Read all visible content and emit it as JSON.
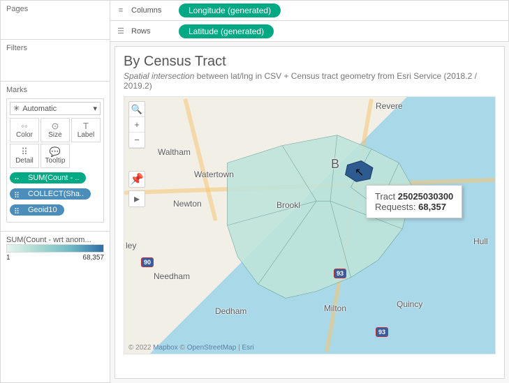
{
  "sidebar": {
    "pages_title": "Pages",
    "filters_title": "Filters",
    "marks_title": "Marks",
    "mark_type": "Automatic",
    "mark_cells": [
      "Color",
      "Size",
      "Label",
      "Detail",
      "Tooltip"
    ],
    "pills": [
      {
        "label": "SUM(Count - ..",
        "cls": "green"
      },
      {
        "label": "COLLECT(Sha..",
        "cls": "blue"
      },
      {
        "label": "Geoid10",
        "cls": "blue"
      }
    ],
    "legend_title": "SUM(Count - wrt anom...",
    "legend_min": "1",
    "legend_max": "68,357"
  },
  "shelves": {
    "columns_label": "Columns",
    "columns_pill": "Longitude (generated)",
    "rows_label": "Rows",
    "rows_pill": "Latitude (generated)"
  },
  "viz": {
    "title": "By Census Tract",
    "sub_em": "Spatial intersection",
    "sub_rest": " between lat/lng in CSV + Census tract geometry from Esri Service (2018.2 / 2019.2)",
    "places": {
      "revere": "Revere",
      "waltham": "Waltham",
      "watertown": "Watertown",
      "b": "B",
      "newton": "Newton",
      "brookl": "Brookl",
      "hull": "Hull",
      "ley": "ley",
      "needham": "Needham",
      "dedham": "Dedham",
      "milton": "Milton",
      "quincy": "Quincy"
    },
    "shields": {
      "i90": "90",
      "i93a": "93",
      "i93b": "93"
    },
    "tooltip": {
      "l1a": "Tract ",
      "l1b": "25025030300",
      "l2a": "Requests: ",
      "l2b": "68,357"
    },
    "attrib": {
      "pre": "© 2022 ",
      "mapbox": "Mapbox",
      "mid": " © ",
      "osm": "OpenStreetMap",
      "sep": " | ",
      "esri": "Esri"
    }
  }
}
